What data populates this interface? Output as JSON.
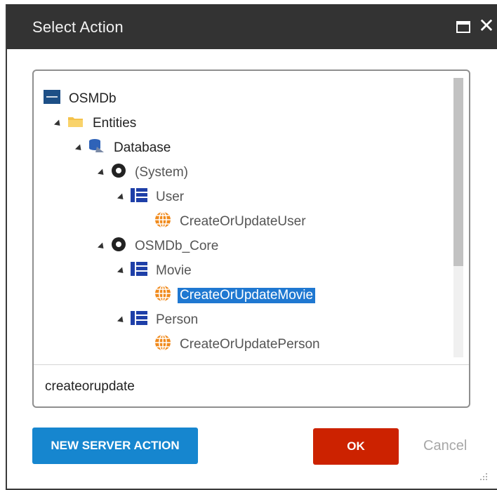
{
  "dialog": {
    "title": "Select Action",
    "window_controls": {
      "maximize_icon": "maximize-icon",
      "close_icon": "close-icon"
    }
  },
  "tree": {
    "root": {
      "label": "OSMDb",
      "icon": "module-icon"
    },
    "entities": {
      "label": "Entities",
      "icon": "folder-icon"
    },
    "database": {
      "label": "Database",
      "icon": "database-icon"
    },
    "system": {
      "label": "(System)",
      "icon": "entity-module-icon"
    },
    "user": {
      "label": "User",
      "icon": "entity-table-icon"
    },
    "create_user": {
      "label": "CreateOrUpdateUser",
      "icon": "action-globe-icon"
    },
    "core": {
      "label": "OSMDb_Core",
      "icon": "entity-module-icon"
    },
    "movie": {
      "label": "Movie",
      "icon": "entity-table-icon"
    },
    "create_movie": {
      "label": "CreateOrUpdateMovie",
      "icon": "action-globe-icon",
      "selected": true
    },
    "person": {
      "label": "Person",
      "icon": "entity-table-icon"
    },
    "create_person": {
      "label": "CreateOrUpdatePerson",
      "icon": "action-globe-icon"
    }
  },
  "search": {
    "value": "createorupdate"
  },
  "buttons": {
    "new_server_action": "NEW SERVER ACTION",
    "ok": "OK",
    "cancel": "Cancel"
  },
  "colors": {
    "titlebar": "#333333",
    "selection": "#1f78d1",
    "primary_button": "#1686cf",
    "ok_button": "#cc2200",
    "action_icon": "#f08a1c",
    "entity_icon": "#1e3fa8"
  }
}
